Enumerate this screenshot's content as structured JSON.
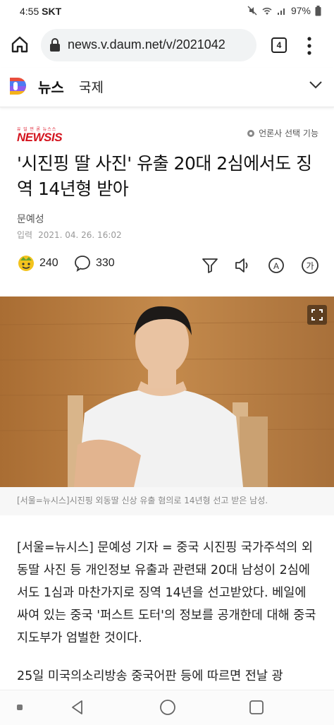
{
  "status": {
    "time": "4:55",
    "carrier": "SKT",
    "battery": "97%"
  },
  "browser": {
    "url": "news.v.daum.net/v/2021042",
    "tab_count": "4"
  },
  "header": {
    "section_news": "뉴스",
    "section_category": "국제"
  },
  "article": {
    "publisher_sub": "유 일 언 론 뉴스스",
    "publisher": "NEWSIS",
    "publisher_select": "언론사 선택 기능",
    "title": "'시진핑 딸 사진' 유출 20대 2심에서도 징역 14년형 받아",
    "author": "문예성",
    "date_label": "입력",
    "date": "2021. 04. 26. 16:02",
    "reactions": "240",
    "comments": "330",
    "caption": "[서울=뉴시스]시진핑 외동딸 신상 유출 혐의로 14년형 선고 받은 남성.",
    "paragraphs": [
      "[서울=뉴시스] 문예성 기자 = 중국 시진핑 국가주석의 외동딸 사진 등 개인정보 유출과 관련돼 20대 남성이 2심에서도 1심과 마찬가지로 징역 14년을 선고받았다. 베일에 싸여 있는 중국 '퍼스트 도터'의 정보를 공개한데 대해 중국 지도부가 엄벌한 것이다.",
      "25일 미국의소리방송 중국어판 등에 따르면 전날 광"
    ]
  },
  "icons": {
    "home": "home-icon",
    "lock": "lock-icon",
    "menu": "more-vert-icon",
    "filter": "filter-icon",
    "speaker": "speaker-icon",
    "translate": "translate-icon",
    "font": "font-size-icon"
  }
}
